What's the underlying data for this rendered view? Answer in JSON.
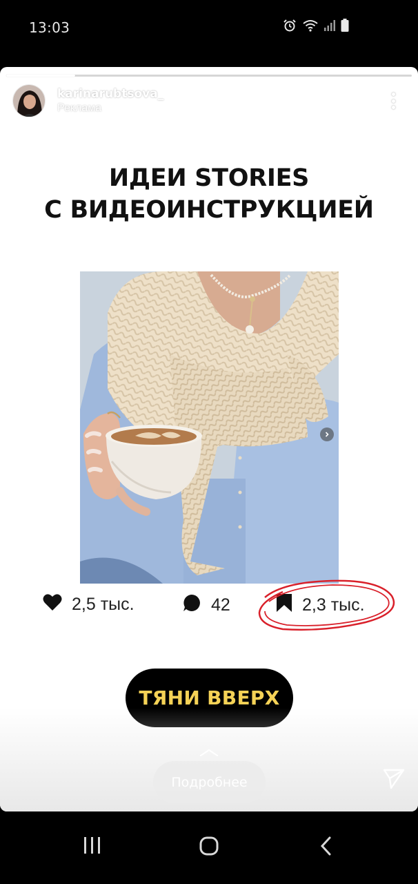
{
  "status_bar": {
    "time": "13:03",
    "icons": [
      "alarm-icon",
      "wifi-icon",
      "signal-icon",
      "battery-icon"
    ]
  },
  "story": {
    "progress": 0.17,
    "account": {
      "username": "karinarubtsova_",
      "sponsored_label": "Реклама"
    },
    "headline": {
      "line1": "ИДЕИ STORIES",
      "line2": "С ВИДЕОИНСТРУКЦИЕЙ"
    },
    "stats": {
      "likes": "2,5 тыс.",
      "comments": "42",
      "saves": "2,3 тыс."
    },
    "cta_label": "ТЯНИ ВВЕРХ",
    "more_label": "Подробнее",
    "colors": {
      "cta_background": "#000000",
      "cta_text": "#f5d256",
      "annotation_circle": "#d9202a"
    }
  },
  "nav_bar": {
    "buttons": [
      "recents-icon",
      "home-icon",
      "back-icon"
    ]
  }
}
